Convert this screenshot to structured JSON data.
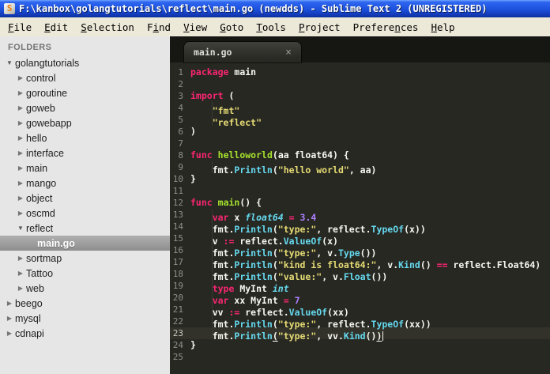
{
  "window": {
    "title": "F:\\kanbox\\golangtutorials\\reflect\\main.go (newdds) - Sublime Text 2 (UNREGISTERED)",
    "app_icon_glyph": "S"
  },
  "menu_bar": {
    "items": [
      {
        "label": "File",
        "underline": 0
      },
      {
        "label": "Edit",
        "underline": 0
      },
      {
        "label": "Selection",
        "underline": 0
      },
      {
        "label": "Find",
        "underline": 1
      },
      {
        "label": "View",
        "underline": 0
      },
      {
        "label": "Goto",
        "underline": 0
      },
      {
        "label": "Tools",
        "underline": 0
      },
      {
        "label": "Project",
        "underline": 0
      },
      {
        "label": "Preferences",
        "underline": 7
      },
      {
        "label": "Help",
        "underline": 0
      }
    ]
  },
  "sidebar": {
    "header": "FOLDERS",
    "items": [
      {
        "label": "golangtutorials",
        "level": 0,
        "state": "expanded",
        "selected": false
      },
      {
        "label": "control",
        "level": 1,
        "state": "collapsed",
        "selected": false
      },
      {
        "label": "goroutine",
        "level": 1,
        "state": "collapsed",
        "selected": false
      },
      {
        "label": "goweb",
        "level": 1,
        "state": "collapsed",
        "selected": false
      },
      {
        "label": "gowebapp",
        "level": 1,
        "state": "collapsed",
        "selected": false
      },
      {
        "label": "hello",
        "level": 1,
        "state": "collapsed",
        "selected": false
      },
      {
        "label": "interface",
        "level": 1,
        "state": "collapsed",
        "selected": false
      },
      {
        "label": "main",
        "level": 1,
        "state": "collapsed",
        "selected": false
      },
      {
        "label": "mango",
        "level": 1,
        "state": "collapsed",
        "selected": false
      },
      {
        "label": "object",
        "level": 1,
        "state": "collapsed",
        "selected": false
      },
      {
        "label": "oscmd",
        "level": 1,
        "state": "collapsed",
        "selected": false
      },
      {
        "label": "reflect",
        "level": 1,
        "state": "expanded",
        "selected": false
      },
      {
        "label": "main.go",
        "level": 2,
        "state": "file",
        "selected": true
      },
      {
        "label": "sortmap",
        "level": 1,
        "state": "collapsed",
        "selected": false
      },
      {
        "label": "Tattoo",
        "level": 1,
        "state": "collapsed",
        "selected": false
      },
      {
        "label": "web",
        "level": 1,
        "state": "collapsed",
        "selected": false
      },
      {
        "label": "beego",
        "level": 0,
        "state": "collapsed",
        "selected": false
      },
      {
        "label": "mysql",
        "level": 0,
        "state": "collapsed",
        "selected": false
      },
      {
        "label": "cdnapi",
        "level": 0,
        "state": "collapsed",
        "selected": false
      }
    ]
  },
  "tab": {
    "label": "main.go",
    "close_glyph": "×",
    "active": true
  },
  "editor": {
    "language": "go",
    "lines": [
      {
        "num": 1,
        "indent": 0,
        "tokens": [
          [
            "k",
            "package"
          ],
          [
            "p",
            " main"
          ]
        ]
      },
      {
        "num": 2,
        "indent": 0,
        "tokens": []
      },
      {
        "num": 3,
        "indent": 0,
        "tokens": [
          [
            "k",
            "import"
          ],
          [
            "p",
            " ("
          ]
        ]
      },
      {
        "num": 4,
        "indent": 1,
        "tokens": [
          [
            "s",
            "\"fmt\""
          ]
        ]
      },
      {
        "num": 5,
        "indent": 1,
        "tokens": [
          [
            "s",
            "\"reflect\""
          ]
        ]
      },
      {
        "num": 6,
        "indent": 0,
        "tokens": [
          [
            "p",
            ")"
          ]
        ]
      },
      {
        "num": 7,
        "indent": 0,
        "tokens": []
      },
      {
        "num": 8,
        "indent": 0,
        "tokens": [
          [
            "k",
            "func"
          ],
          [
            "p",
            " "
          ],
          [
            "f",
            "helloworld"
          ],
          [
            "p",
            "(aa float64) {"
          ]
        ]
      },
      {
        "num": 9,
        "indent": 1,
        "tokens": [
          [
            "p",
            "fmt."
          ],
          [
            "c",
            "Println"
          ],
          [
            "p",
            "("
          ],
          [
            "s",
            "\"hello world\""
          ],
          [
            "p",
            ", aa)"
          ]
        ]
      },
      {
        "num": 10,
        "indent": 0,
        "tokens": [
          [
            "p",
            "}"
          ]
        ]
      },
      {
        "num": 11,
        "indent": 0,
        "tokens": []
      },
      {
        "num": 12,
        "indent": 0,
        "tokens": [
          [
            "k",
            "func"
          ],
          [
            "p",
            " "
          ],
          [
            "f",
            "main"
          ],
          [
            "p",
            "() {"
          ]
        ]
      },
      {
        "num": 13,
        "indent": 1,
        "tokens": [
          [
            "k",
            "var"
          ],
          [
            "p",
            " x "
          ],
          [
            "t",
            "float64"
          ],
          [
            "p",
            " "
          ],
          [
            "k",
            "="
          ],
          [
            "p",
            " "
          ],
          [
            "n",
            "3.4"
          ]
        ]
      },
      {
        "num": 14,
        "indent": 1,
        "tokens": [
          [
            "p",
            "fmt."
          ],
          [
            "c",
            "Println"
          ],
          [
            "p",
            "("
          ],
          [
            "s",
            "\"type:\""
          ],
          [
            "p",
            ", reflect."
          ],
          [
            "c",
            "TypeOf"
          ],
          [
            "p",
            "(x))"
          ]
        ]
      },
      {
        "num": 15,
        "indent": 1,
        "tokens": [
          [
            "p",
            "v "
          ],
          [
            "k",
            ":="
          ],
          [
            "p",
            " reflect."
          ],
          [
            "c",
            "ValueOf"
          ],
          [
            "p",
            "(x)"
          ]
        ]
      },
      {
        "num": 16,
        "indent": 1,
        "tokens": [
          [
            "p",
            "fmt."
          ],
          [
            "c",
            "Println"
          ],
          [
            "p",
            "("
          ],
          [
            "s",
            "\"type:\""
          ],
          [
            "p",
            ", v."
          ],
          [
            "c",
            "Type"
          ],
          [
            "p",
            "())"
          ]
        ]
      },
      {
        "num": 17,
        "indent": 1,
        "tokens": [
          [
            "p",
            "fmt."
          ],
          [
            "c",
            "Println"
          ],
          [
            "p",
            "("
          ],
          [
            "s",
            "\"kind is float64:\""
          ],
          [
            "p",
            ", v."
          ],
          [
            "c",
            "Kind"
          ],
          [
            "p",
            "() "
          ],
          [
            "k",
            "=="
          ],
          [
            "p",
            " reflect.Float64)"
          ]
        ]
      },
      {
        "num": 18,
        "indent": 1,
        "tokens": [
          [
            "p",
            "fmt."
          ],
          [
            "c",
            "Println"
          ],
          [
            "p",
            "("
          ],
          [
            "s",
            "\"value:\""
          ],
          [
            "p",
            ", v."
          ],
          [
            "c",
            "Float"
          ],
          [
            "p",
            "())"
          ]
        ]
      },
      {
        "num": 19,
        "indent": 1,
        "tokens": [
          [
            "k",
            "type"
          ],
          [
            "p",
            " MyInt "
          ],
          [
            "t",
            "int"
          ]
        ]
      },
      {
        "num": 20,
        "indent": 1,
        "tokens": [
          [
            "k",
            "var"
          ],
          [
            "p",
            " xx MyInt "
          ],
          [
            "k",
            "="
          ],
          [
            "p",
            " "
          ],
          [
            "n",
            "7"
          ]
        ]
      },
      {
        "num": 21,
        "indent": 1,
        "tokens": [
          [
            "p",
            "vv "
          ],
          [
            "k",
            ":="
          ],
          [
            "p",
            " reflect."
          ],
          [
            "c",
            "ValueOf"
          ],
          [
            "p",
            "(xx)"
          ]
        ]
      },
      {
        "num": 22,
        "indent": 1,
        "tokens": [
          [
            "p",
            "fmt."
          ],
          [
            "c",
            "Println"
          ],
          [
            "p",
            "("
          ],
          [
            "s",
            "\"type:\""
          ],
          [
            "p",
            ", reflect."
          ],
          [
            "c",
            "TypeOf"
          ],
          [
            "p",
            "(xx))"
          ]
        ]
      },
      {
        "num": 23,
        "indent": 1,
        "current": true,
        "caret": true,
        "tokens": [
          [
            "p",
            "fmt."
          ],
          [
            "c",
            "Println"
          ],
          [
            "pu",
            "("
          ],
          [
            "s",
            "\"type:\""
          ],
          [
            "p",
            ", vv."
          ],
          [
            "c",
            "Kind"
          ],
          [
            "p",
            "()"
          ],
          [
            "pu",
            ")"
          ]
        ]
      },
      {
        "num": 24,
        "indent": 0,
        "tokens": [
          [
            "p",
            "}"
          ]
        ]
      },
      {
        "num": 25,
        "indent": 0,
        "tokens": []
      }
    ]
  },
  "colors": {
    "titlebar_blue": "#1D52D8",
    "menubar_bg": "#ECE9D8",
    "sidebar_bg": "#E6E6E6",
    "sidebar_sel": "#9B9B9B",
    "editor_bg": "#272822",
    "tabbar_bg": "#161613",
    "keyword": "#F92672",
    "string": "#E6DB74",
    "func_def": "#A6E22E",
    "func_call": "#66D9EF",
    "type": "#66D9EF",
    "number": "#AE81FF",
    "plain": "#F8F8F2",
    "line_num": "#90908A"
  }
}
